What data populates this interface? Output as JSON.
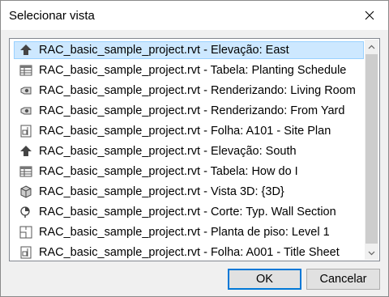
{
  "window": {
    "title": "Selecionar vista"
  },
  "list": {
    "items": [
      {
        "label": "RAC_basic_sample_project.rvt - Elevação: East",
        "icon": "elevation-icon",
        "selected": true
      },
      {
        "label": "RAC_basic_sample_project.rvt - Tabela: Planting Schedule",
        "icon": "schedule-icon",
        "selected": false
      },
      {
        "label": "RAC_basic_sample_project.rvt - Renderizando: Living Room",
        "icon": "rendering-icon",
        "selected": false
      },
      {
        "label": "RAC_basic_sample_project.rvt - Renderizando: From Yard",
        "icon": "rendering-icon",
        "selected": false
      },
      {
        "label": "RAC_basic_sample_project.rvt - Folha: A101 - Site Plan",
        "icon": "sheet-icon",
        "selected": false
      },
      {
        "label": "RAC_basic_sample_project.rvt - Elevação: South",
        "icon": "elevation-icon",
        "selected": false
      },
      {
        "label": "RAC_basic_sample_project.rvt - Tabela: How do I",
        "icon": "schedule-icon",
        "selected": false
      },
      {
        "label": "RAC_basic_sample_project.rvt - Vista 3D: {3D}",
        "icon": "3d-view-icon",
        "selected": false
      },
      {
        "label": "RAC_basic_sample_project.rvt - Corte: Typ. Wall Section",
        "icon": "section-icon",
        "selected": false
      },
      {
        "label": "RAC_basic_sample_project.rvt - Planta de piso: Level 1",
        "icon": "floor-plan-icon",
        "selected": false
      },
      {
        "label": "RAC_basic_sample_project.rvt - Folha: A001 - Title Sheet",
        "icon": "sheet-icon",
        "selected": false
      }
    ]
  },
  "buttons": {
    "ok": "OK",
    "cancel": "Cancelar"
  },
  "colors": {
    "selection_bg": "#cde8ff",
    "selection_border": "#99d1ff",
    "default_button_border": "#0078d7"
  }
}
